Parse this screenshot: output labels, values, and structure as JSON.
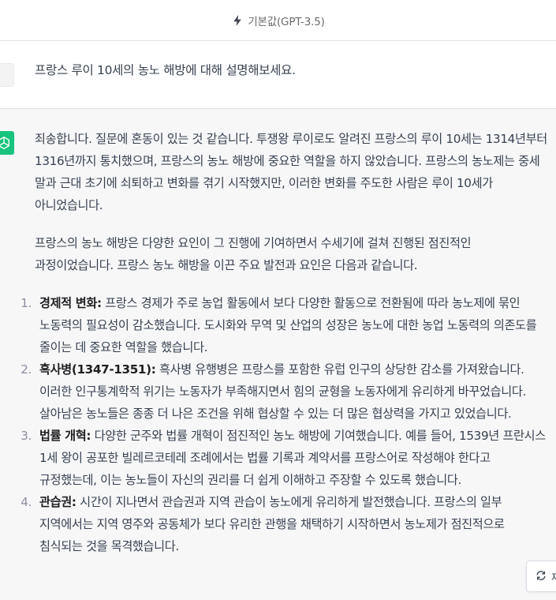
{
  "model_bar": {
    "label": "기본값(GPT-3.5)",
    "icon": "lightning-bolt-icon"
  },
  "user_message": {
    "text": "프랑스 루이 10세의 농노 해방에 대해 설명해보세요."
  },
  "assistant_message": {
    "paragraphs": [
      "죄송합니다. 질문에 혼동이 있는 것 같습니다. 투쟁왕 루이로도 알려진 프랑스의 루이 10세는 1314년부터 1316년까지 통치했으며, 프랑스의 농노 해방에 중요한 역할을 하지 않았습니다. 프랑스의 농노제는 중세 말과 근대 초기에 쇠퇴하고 변화를 겪기 시작했지만, 이러한 변화를 주도한 사람은 루이 10세가 아니었습니다.",
      "프랑스의 농노 해방은 다양한 요인이 그 진행에 기여하면서 수세기에 걸쳐 진행된 점진적인 과정이었습니다. 프랑스 농노 해방을 이끈 주요 발전과 요인은 다음과 같습니다."
    ],
    "list": [
      {
        "num": "1.",
        "title": "경제적 변화:",
        "text": " 프랑스 경제가 주로 농업 활동에서 보다 다양한 활동으로 전환됨에 따라 농노제에 묶인 노동력의 필요성이 감소했습니다. 도시화와 무역 및 산업의 성장은 농노에 대한 농업 노동력의 의존도를 줄이는 데 중요한 역할을 했습니다."
      },
      {
        "num": "2.",
        "title": "흑사병(1347-1351):",
        "text": " 흑사병 유행병은 프랑스를 포함한 유럽 인구의 상당한 감소를 가져왔습니다. 이러한 인구통계학적 위기는 노동자가 부족해지면서 힘의 균형을 노동자에게 유리하게 바꾸었습니다. 살아남은 농노들은 종종 더 나은 조건을 위해 협상할 수 있는 더 많은 협상력을 가지고 있었습니다."
      },
      {
        "num": "3.",
        "title": "법률 개혁:",
        "text": " 다양한 군주와 법률 개혁이 점진적인 농노 해방에 기여했습니다. 예를 들어, 1539년 프란시스 1세 왕이 공포한 빌레르코테레 조례에서는 법률 기록과 계약서를 프랑스어로 작성해야 한다고 규정했는데, 이는 농노들이 자신의 권리를 더 쉽게 이해하고 주장할 수 있도록 했습니다."
      },
      {
        "num": "4.",
        "title": "관습권:",
        "text": " 시간이 지나면서 관습권과 지역 관습이 농노에게 유리하게 발전했습니다. 프랑스의 일부 지역에서는 지역 영주와 공동체가 보다 유리한 관행을 채택하기 시작하면서 농노제가 점진적으로 침식되는 것을 목격했습니다."
      }
    ]
  },
  "regenerate_button": {
    "label": "재",
    "icon": "refresh-icon"
  }
}
